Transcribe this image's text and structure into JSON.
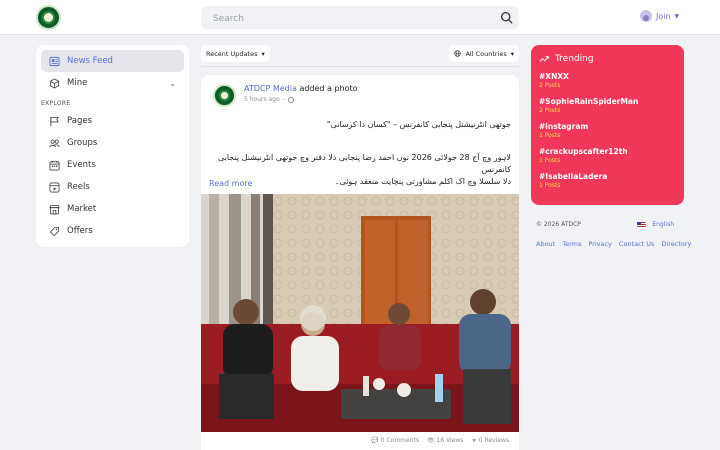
{
  "header": {
    "search_placeholder": "Search",
    "join_label": "Join"
  },
  "sidebar": {
    "items": [
      {
        "label": "News Feed",
        "icon": "news-feed-icon",
        "active": true
      },
      {
        "label": "Mine",
        "icon": "cube-icon",
        "active": false
      }
    ],
    "explore_heading": "EXPLORE",
    "explore_items": [
      {
        "label": "Pages",
        "icon": "flag-icon"
      },
      {
        "label": "Groups",
        "icon": "groups-icon"
      },
      {
        "label": "Events",
        "icon": "calendar-icon"
      },
      {
        "label": "Reels",
        "icon": "reels-icon"
      },
      {
        "label": "Market",
        "icon": "market-icon"
      },
      {
        "label": "Offers",
        "icon": "tag-icon"
      }
    ]
  },
  "feed": {
    "sort_label": "Recent Updates",
    "country_label": "All Countries"
  },
  "post": {
    "author": "ATDCP Media",
    "action": "added a photo",
    "time": "5 hours ago",
    "line1": "جوتھی انٹرنیشنل پنجابی کانفرنس – \"کسان دا کرسانی\"",
    "line2a": "لاہور وچ آج 28 جولائی 2026 نوں احمد رضا پنجابی دلا دفتر وچ جوتھی انٹرنیشنل پنجابی کانفرنس",
    "line2b": "دلا سلسلا وچ اک اکلم مشاورتی پنچایت منعقد ہوئی۔",
    "read_more": "Read more",
    "comments": "0 Comments",
    "views": "16 Views",
    "reviews": "0 Reviews"
  },
  "trending": {
    "title": "Trending",
    "items": [
      {
        "tag": "#XNXX",
        "count": "2 Posts"
      },
      {
        "tag": "#SophieRainSpiderMan",
        "count": "2 Posts"
      },
      {
        "tag": "#instagram",
        "count": "1 Posts"
      },
      {
        "tag": "#crackupscafter12th",
        "count": "1 Posts"
      },
      {
        "tag": "#IsabellaLadera",
        "count": "1 Posts"
      }
    ]
  },
  "footer": {
    "copyright": "© 2026 ATDCP",
    "language": "English",
    "links": [
      "About",
      "Terms",
      "Privacy",
      "Contact Us",
      "Directory"
    ]
  },
  "colors": {
    "accent": "#5b6fd6",
    "trending_bg": "#f2385a",
    "trending_count": "#ffd84d"
  }
}
